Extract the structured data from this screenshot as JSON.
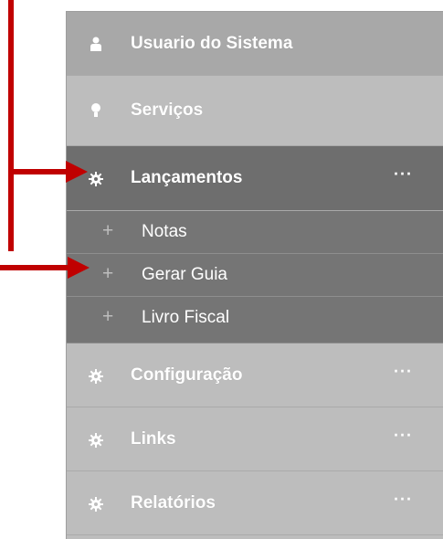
{
  "menu": {
    "user": {
      "label": "Usuario do Sistema",
      "icon": "user-icon"
    },
    "services": {
      "label": "Serviços",
      "icon": "bulb-icon"
    },
    "launches": {
      "label": "Lançamentos",
      "icon": "gear-icon",
      "more": "···"
    },
    "sub_items": [
      {
        "label": "Notas",
        "icon": "plus-icon"
      },
      {
        "label": "Gerar Guia",
        "icon": "plus-icon"
      },
      {
        "label": "Livro Fiscal",
        "icon": "plus-icon"
      }
    ],
    "config": {
      "label": "Configuração",
      "icon": "gear-icon",
      "more": "···"
    },
    "links": {
      "label": "Links",
      "icon": "gear-icon",
      "more": "···"
    },
    "reports": {
      "label": "Relatórios",
      "icon": "gear-icon",
      "more": "···"
    }
  },
  "colors": {
    "menu_bg": "#bdbdbd",
    "active_bg": "#6e6e6e",
    "sub_bg": "#757575",
    "header_bg": "#a8a8a8",
    "annotation_arrow": "#c00000"
  }
}
